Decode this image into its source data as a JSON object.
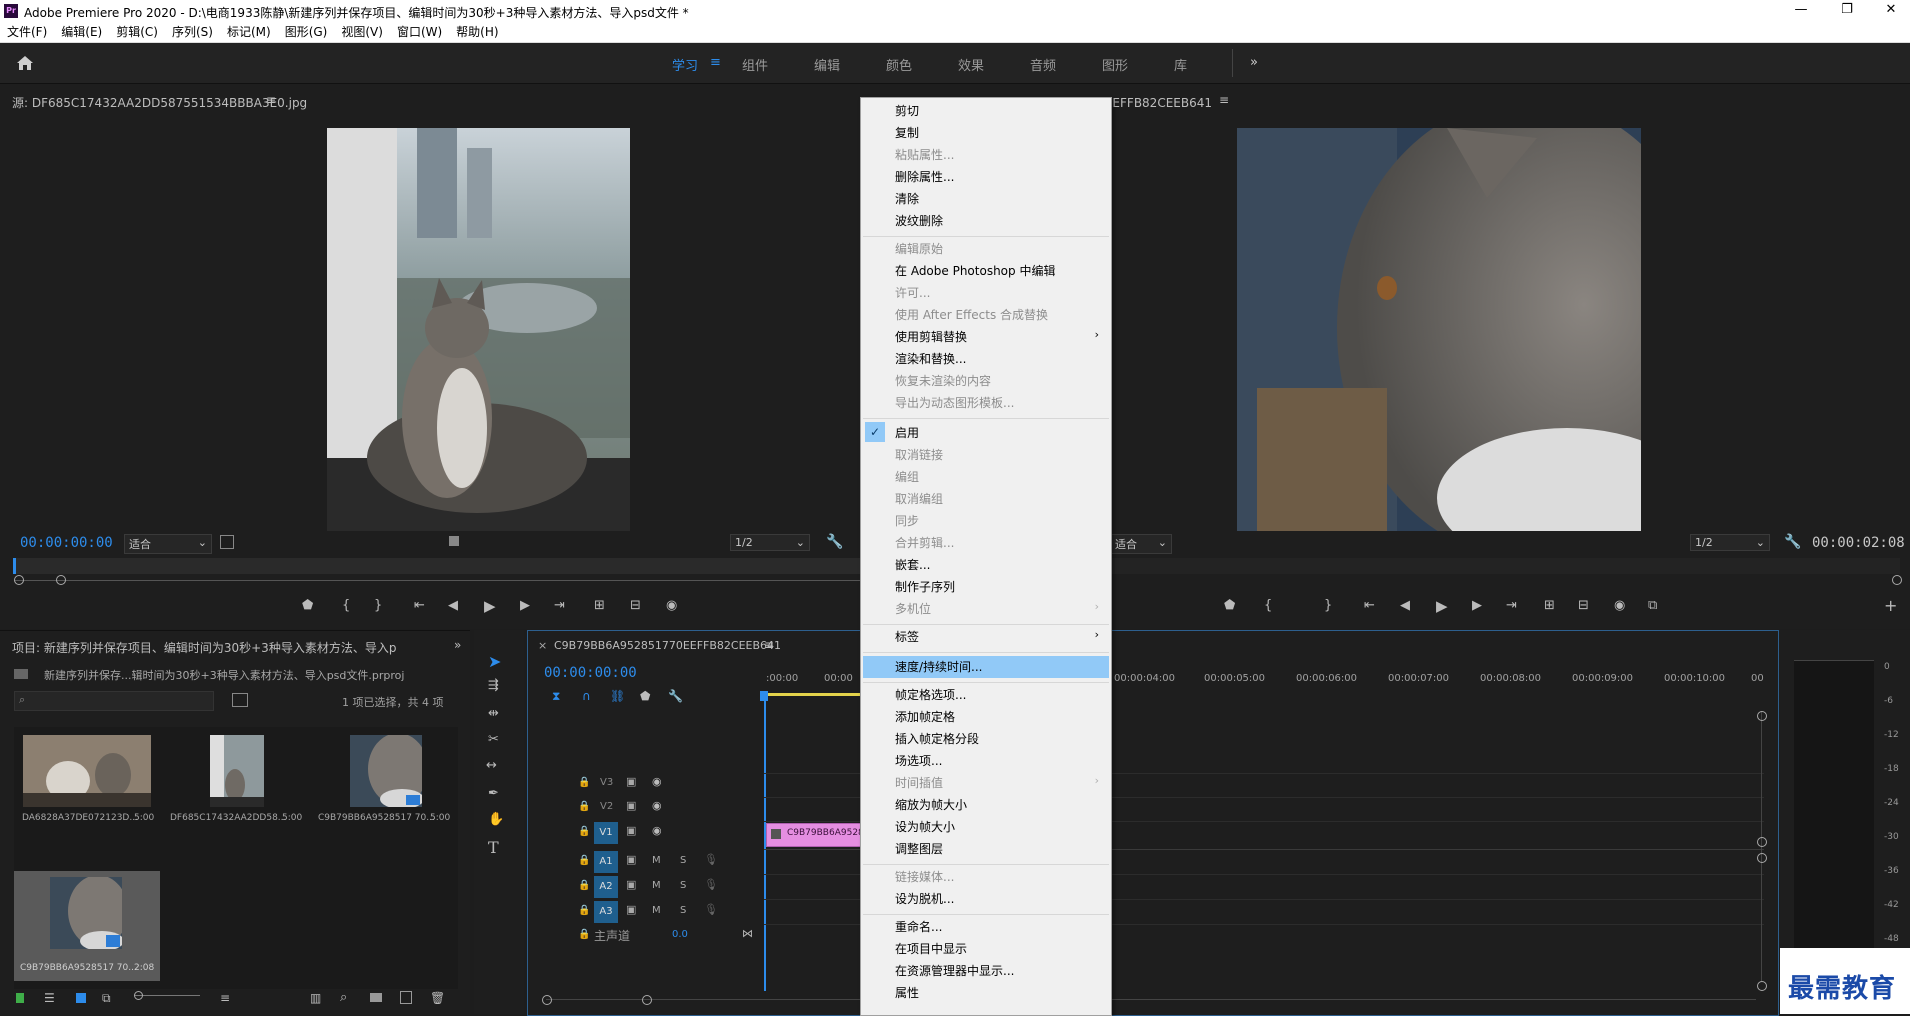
{
  "window": {
    "title": "Adobe Premiere Pro 2020 - D:\\电商1933陈静\\新建序列并保存项目、编辑时间为30秒+3种导入素材方法、导入psd文件 *",
    "logo": "Pr",
    "minimize": "—",
    "restore": "❐",
    "close": "✕"
  },
  "menu": [
    "文件(F)",
    "编辑(E)",
    "剪辑(C)",
    "序列(S)",
    "标记(M)",
    "图形(G)",
    "视图(V)",
    "窗口(W)",
    "帮助(H)"
  ],
  "workspaces": {
    "items": [
      "学习",
      "组件",
      "编辑",
      "颜色",
      "效果",
      "音频",
      "图形",
      "库"
    ],
    "active": "学习",
    "more": "»"
  },
  "source_monitor": {
    "title": "源: DF685C17432AA2DD587551534BBBA3E0.jpg",
    "timecode": "00:00:00:00",
    "fit": "适合",
    "resolution": "1/2"
  },
  "program_monitor": {
    "title": "节目: C9B79BB6A952851770EEFFB82CEEB641",
    "timecode": "00:00:02:08",
    "fit": "适合",
    "resolution": "1/2"
  },
  "project": {
    "title": "项目: 新建序列并保存项目、编辑时间为30秒+3种导入素材方法、导入p",
    "file": "新建序列并保存...辑时间为30秒+3种导入素材方法、导入psd文件.prproj",
    "selection": "1 项已选择，共 4 项",
    "more": "»",
    "items": [
      {
        "name": "DA6828A37DE072123D...",
        "duration": "5:00"
      },
      {
        "name": "DF685C17432AA2DD58...",
        "duration": "5:00"
      },
      {
        "name": "C9B79BB6A9528517 70...",
        "duration": "5:00"
      },
      {
        "name": "C9B79BB6A9528517 70...",
        "duration": "2:08"
      }
    ]
  },
  "timeline": {
    "sequence": "C9B79BB6A952851770EEFFB82CEEB641",
    "timecode": "00:00:00:00",
    "ruler": [
      ":00:00",
      "00:00",
      "00:00:04:00",
      "00:00:05:00",
      "00:00:06:00",
      "00:00:07:00",
      "00:00:08:00",
      "00:00:09:00",
      "00:00:10:00",
      "00"
    ],
    "video_tracks": [
      "V3",
      "V2",
      "V1"
    ],
    "audio_tracks": [
      "A1",
      "A2",
      "A3"
    ],
    "master": "主声道",
    "master_value": "0.0",
    "mute": "M",
    "solo": "S",
    "clip": "C9B79BB6A9528"
  },
  "context_menu": {
    "items": [
      {
        "label": "剪切",
        "enabled": true
      },
      {
        "label": "复制",
        "enabled": true
      },
      {
        "label": "粘贴属性...",
        "enabled": false
      },
      {
        "label": "删除属性...",
        "enabled": true
      },
      {
        "label": "清除",
        "enabled": true
      },
      {
        "label": "波纹删除",
        "enabled": true
      },
      {
        "label": "编辑原始",
        "enabled": false
      },
      {
        "label": "在 Adobe Photoshop 中编辑",
        "enabled": true
      },
      {
        "label": "许可...",
        "enabled": false
      },
      {
        "label": "使用 After Effects 合成替换",
        "enabled": false
      },
      {
        "label": "使用剪辑替换",
        "enabled": true,
        "submenu": true
      },
      {
        "label": "渲染和替换...",
        "enabled": true
      },
      {
        "label": "恢复未渲染的内容",
        "enabled": false
      },
      {
        "label": "导出为动态图形模板...",
        "enabled": false
      },
      {
        "label": "启用",
        "enabled": true,
        "checked": true
      },
      {
        "label": "取消链接",
        "enabled": false
      },
      {
        "label": "编组",
        "enabled": false
      },
      {
        "label": "取消编组",
        "enabled": false
      },
      {
        "label": "同步",
        "enabled": false
      },
      {
        "label": "合并剪辑...",
        "enabled": false
      },
      {
        "label": "嵌套...",
        "enabled": true
      },
      {
        "label": "制作子序列",
        "enabled": true
      },
      {
        "label": "多机位",
        "enabled": false,
        "submenu": true
      },
      {
        "label": "标签",
        "enabled": true,
        "submenu": true
      },
      {
        "label": "速度/持续时间...",
        "enabled": true,
        "highlighted": true
      },
      {
        "label": "帧定格选项...",
        "enabled": true
      },
      {
        "label": "添加帧定格",
        "enabled": true
      },
      {
        "label": "插入帧定格分段",
        "enabled": true
      },
      {
        "label": "场选项...",
        "enabled": true
      },
      {
        "label": "时间插值",
        "enabled": false,
        "submenu": true
      },
      {
        "label": "缩放为帧大小",
        "enabled": true
      },
      {
        "label": "设为帧大小",
        "enabled": true
      },
      {
        "label": "调整图层",
        "enabled": true
      },
      {
        "label": "链接媒体...",
        "enabled": false
      },
      {
        "label": "设为脱机...",
        "enabled": true
      },
      {
        "label": "重命名...",
        "enabled": true
      },
      {
        "label": "在项目中显示",
        "enabled": true
      },
      {
        "label": "在资源管理器中显示...",
        "enabled": true
      },
      {
        "label": "属性",
        "enabled": true
      }
    ],
    "check_mark": "✓",
    "submenu_arrow": "›"
  },
  "audio_meter": {
    "scale": [
      "0",
      "-6",
      "-12",
      "-18",
      "-24",
      "-30",
      "-36",
      "-42",
      "-48"
    ]
  },
  "watermark": "最需教育",
  "colors": {
    "accent": "#2d8ceb",
    "clip": "#e58ee1",
    "menu_highlight": "#91c9f7",
    "track_target": "#1f5f8e"
  }
}
